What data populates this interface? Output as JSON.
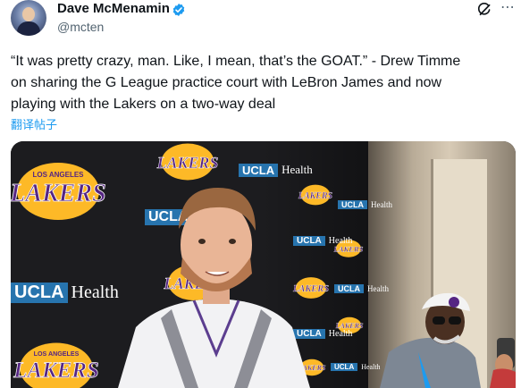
{
  "author": {
    "name": "Dave McMenamin",
    "handle": "@mcten"
  },
  "tweet": {
    "text": "“It was pretty crazy, man. Like, I mean, that’s the GOAT.” - Drew Timme\non sharing the G League practice court with LeBron James and now\nplaying with the Lakers on a two-way deal",
    "translate_label": "翻译帖子"
  },
  "icons": [
    "verified-badge-icon",
    "grok-icon",
    "more-options-icon"
  ],
  "media": {
    "backdrop_sponsor_box": "UCLA",
    "backdrop_sponsor_word": "Health",
    "logo_top": "LOS ANGELES",
    "logo_main": "LAKERS"
  },
  "colors": {
    "verified": "#1d9bf0",
    "link": "#1d9bf0",
    "lakers_purple": "#552583",
    "lakers_gold": "#fdb927",
    "ucla_blue": "#2774ae"
  }
}
